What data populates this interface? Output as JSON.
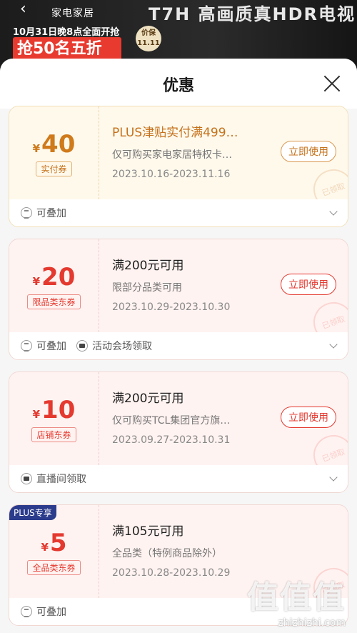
{
  "banner": {
    "back_icon": "‹",
    "brand": "家电家居",
    "date": "10月31日晚8点全面开抢",
    "price_protect": "价保 11.11",
    "sale": "抢50名五折",
    "tv_title": "T7H 高画质真HDR电视"
  },
  "sheet": {
    "title": "优惠"
  },
  "coupons": [
    {
      "amount": "40",
      "yen": "¥",
      "tag": "实付券",
      "title": "PLUS津贴实付满499…",
      "desc": "仅可购买家电家居特权卡…",
      "date": "2023.10.16-2023.11.16",
      "button": "立即使用",
      "stamp": "已领取",
      "features": [
        "可叠加"
      ]
    },
    {
      "amount": "20",
      "yen": "¥",
      "tag": "限品类东券",
      "title": "满200元可用",
      "desc": "限部分品类可用",
      "date": "2023.10.29-2023.10.30",
      "button": "立即使用",
      "stamp": "已领取",
      "features": [
        "可叠加",
        "活动会场领取"
      ]
    },
    {
      "amount": "10",
      "yen": "¥",
      "tag": "店铺东券",
      "title": "满200元可用",
      "desc": "仅可购买TCL集团官方旗…",
      "date": "2023.09.27-2023.10.31",
      "button": "立即使用",
      "stamp": "已领取",
      "features": [
        "直播间领取"
      ]
    },
    {
      "badge": "PLUS专享",
      "amount": "5",
      "yen": "¥",
      "tag": "全品类东券",
      "title": "满105元可用",
      "desc": "全品类（特例商品除外）",
      "date": "2023.10.28-2023.10.29",
      "stamp": "已领取",
      "features": [
        "可叠加"
      ]
    }
  ],
  "watermark": {
    "logo": "值值值",
    "url": "zhizhizhi.com"
  },
  "colors": {
    "gold": "#cf7a1b",
    "red": "#e4392f",
    "plus_badge": "#2c3c8c"
  }
}
